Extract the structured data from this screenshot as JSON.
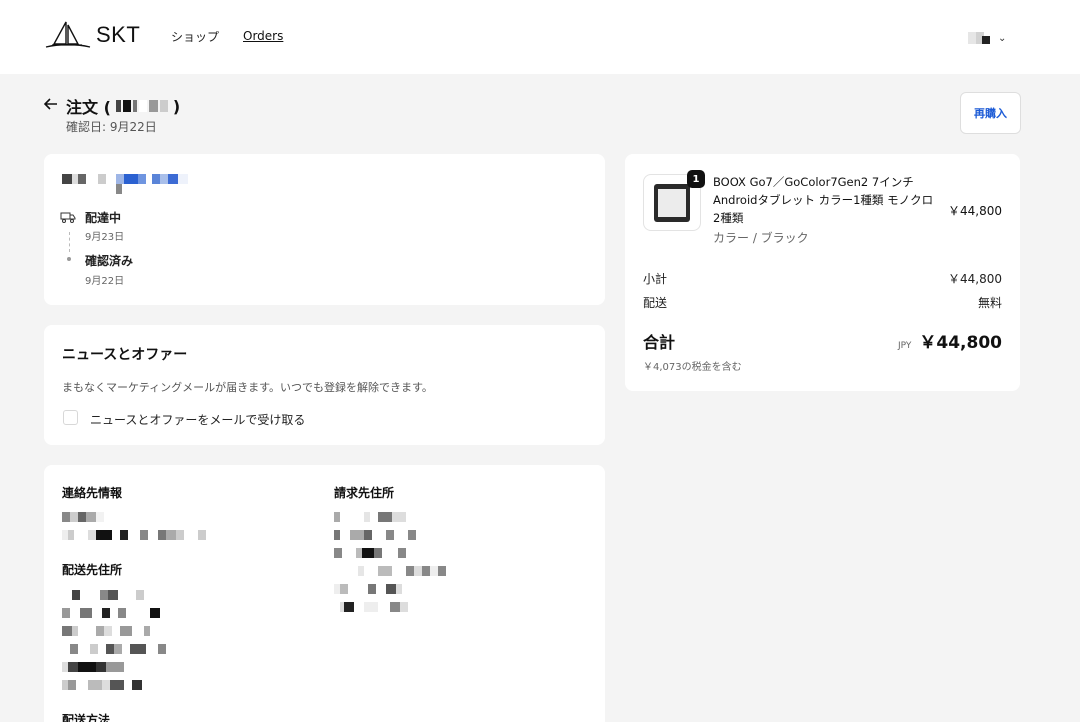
{
  "header": {
    "brand": "SKT",
    "nav": {
      "shop": "ショップ",
      "orders": "Orders"
    },
    "account_chevron": "⌄"
  },
  "order": {
    "title_prefix": "注文 (",
    "title_suffix": ")",
    "confirmed_date": "確認日: 9月22日",
    "rebuy_label": "再購入"
  },
  "status": {
    "steps": [
      {
        "label": "配達中",
        "date": "9月23日",
        "icon": "truck-icon"
      },
      {
        "label": "確認済み",
        "date": "9月22日",
        "icon": "dot-icon"
      }
    ]
  },
  "news": {
    "title": "ニュースとオファー",
    "description": "まもなくマーケティングメールが届きます。いつでも登録を解除できます。",
    "checkbox_label": "ニュースとオファーをメールで受け取る",
    "checked": false
  },
  "info": {
    "contact_label": "連絡先情報",
    "billing_label": "請求先住所",
    "shipping_label": "配送先住所",
    "shipping_method_label": "配送方法"
  },
  "summary": {
    "item": {
      "quantity": "1",
      "name": "BOOX Go7／GoColor7Gen2 7インチAndroidタブレット カラー1種類 モノクロ2種類",
      "variant": "カラー / ブラック",
      "price": "￥44,800"
    },
    "subtotal_label": "小計",
    "subtotal_value": "￥44,800",
    "shipping_label": "配送",
    "shipping_value": "無料",
    "total_label": "合計",
    "currency": "JPY",
    "total_value": "￥44,800",
    "tax_note": "￥4,073の税金を含む"
  },
  "colors": {
    "accent": "#1c5bd6",
    "background": "#f4f4f4",
    "card": "#ffffff"
  }
}
